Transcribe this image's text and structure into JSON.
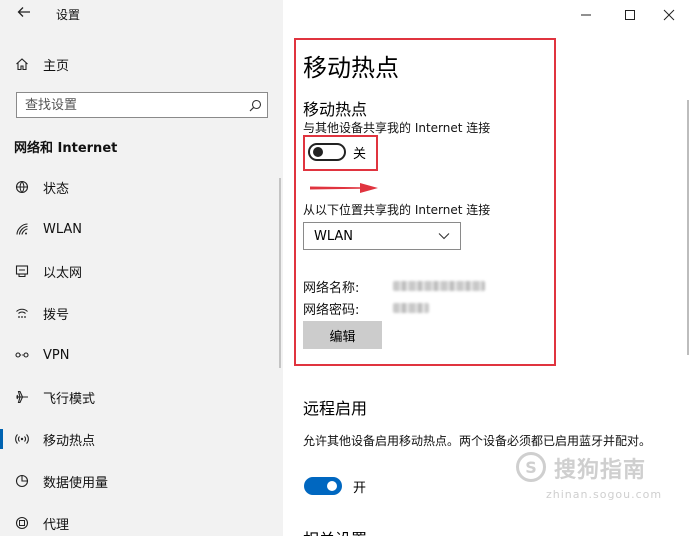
{
  "window": {
    "title": "设置",
    "back_icon": "back-arrow-icon",
    "controls": [
      "minimize-icon",
      "maximize-icon",
      "close-icon"
    ]
  },
  "sidebar": {
    "home": {
      "icon": "home-icon",
      "label": "主页"
    },
    "search": {
      "placeholder": "查找设置",
      "icon": "search-icon"
    },
    "section_title": "网络和 Internet",
    "items": [
      {
        "icon": "globe-icon",
        "label": "状态"
      },
      {
        "icon": "wifi-icon",
        "label": "WLAN"
      },
      {
        "icon": "ethernet-icon",
        "label": "以太网"
      },
      {
        "icon": "dialup-icon",
        "label": "拨号"
      },
      {
        "icon": "vpn-icon",
        "label": "VPN"
      },
      {
        "icon": "airplane-icon",
        "label": "飞行模式"
      },
      {
        "icon": "hotspot-icon",
        "label": "移动热点",
        "active": true
      },
      {
        "icon": "data-usage-icon",
        "label": "数据使用量"
      },
      {
        "icon": "proxy-icon",
        "label": "代理"
      }
    ]
  },
  "main": {
    "page_title": "移动热点",
    "hotspot": {
      "heading": "移动热点",
      "share_desc": "与其他设备共享我的 Internet 连接",
      "toggle_state": false,
      "toggle_label": "关",
      "share_from_label": "从以下位置共享我的 Internet 连接",
      "share_from_value": "WLAN",
      "network_name_label": "网络名称:",
      "network_password_label": "网络密码:",
      "edit_button": "编辑"
    },
    "remote": {
      "heading": "远程启用",
      "desc": "允许其他设备启用移动热点。两个设备必须都已启用蓝牙并配对。",
      "toggle_state": true,
      "toggle_label": "开"
    },
    "related_heading": "相关设置"
  },
  "annotation": {
    "highlight_color": "#e0343f",
    "accent_color": "#0067c0"
  },
  "watermark": {
    "logo_text": "S",
    "text": "搜狗指南",
    "sub": "zhinan.sogou.com"
  }
}
